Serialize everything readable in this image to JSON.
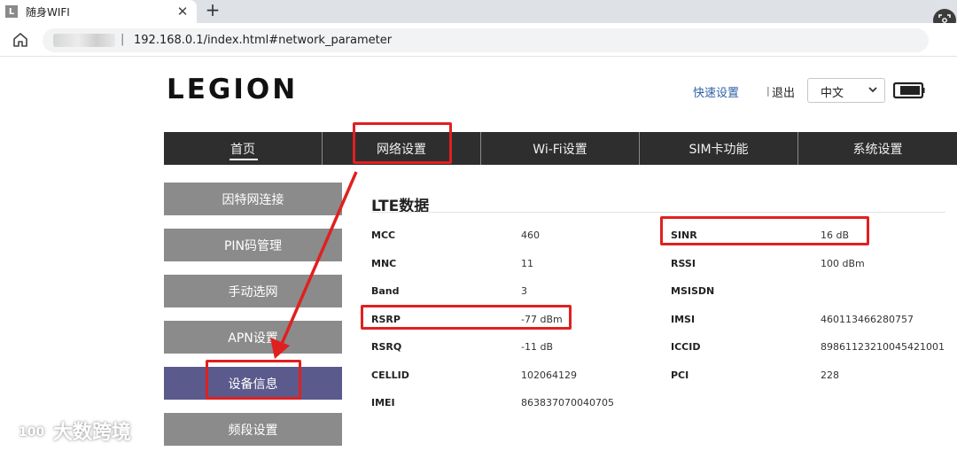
{
  "browser": {
    "tab_favicon": "L",
    "tab_title": "随身WIFI",
    "tab_close": "✕",
    "new_tab": "+",
    "url": "192.168.0.1/index.html#network_parameter",
    "url_separator": "|"
  },
  "header": {
    "logo": "LEGION",
    "quick_settings": "快速设置",
    "separator": "|",
    "logout": "退出",
    "language": "中文"
  },
  "nav": {
    "items": [
      {
        "label": "首页"
      },
      {
        "label": "网络设置"
      },
      {
        "label": "Wi-Fi设置"
      },
      {
        "label": "SIM卡功能"
      },
      {
        "label": "系统设置"
      }
    ]
  },
  "sidebar": {
    "items": [
      {
        "label": "因特网连接"
      },
      {
        "label": "PIN码管理"
      },
      {
        "label": "手动选网"
      },
      {
        "label": "APN设置"
      },
      {
        "label": "设备信息"
      },
      {
        "label": "频段设置"
      }
    ]
  },
  "lte": {
    "title": "LTE数据",
    "rows": [
      {
        "label": "MCC",
        "value": "460",
        "label2": "SINR",
        "value2": "16 dB"
      },
      {
        "label": "MNC",
        "value": "11",
        "label2": "RSSI",
        "value2": "100 dBm"
      },
      {
        "label": "Band",
        "value": "3",
        "label2": "MSISDN",
        "value2": ""
      },
      {
        "label": "RSRP",
        "value": "-77 dBm",
        "label2": "IMSI",
        "value2": "460113466280757"
      },
      {
        "label": "RSRQ",
        "value": "-11 dB",
        "label2": "ICCID",
        "value2": "89861123210045421001"
      },
      {
        "label": "CELLID",
        "value": "102064129",
        "label2": "PCI",
        "value2": "228"
      },
      {
        "label": "IMEI",
        "value": "863837070040705",
        "label2": "",
        "value2": ""
      }
    ]
  },
  "watermark": {
    "text": "大数跨境"
  },
  "colors": {
    "nav_bg": "#2e2e2e",
    "side_item_bg": "#8b8b8b",
    "side_item_active_bg": "#5b5a8c",
    "annotation_red": "#e02020",
    "link_blue": "#2f5fa7"
  },
  "icons": [
    "home-icon",
    "lens-icon",
    "chevron-down-icon",
    "battery-icon",
    "watermark-logo-icon"
  ]
}
